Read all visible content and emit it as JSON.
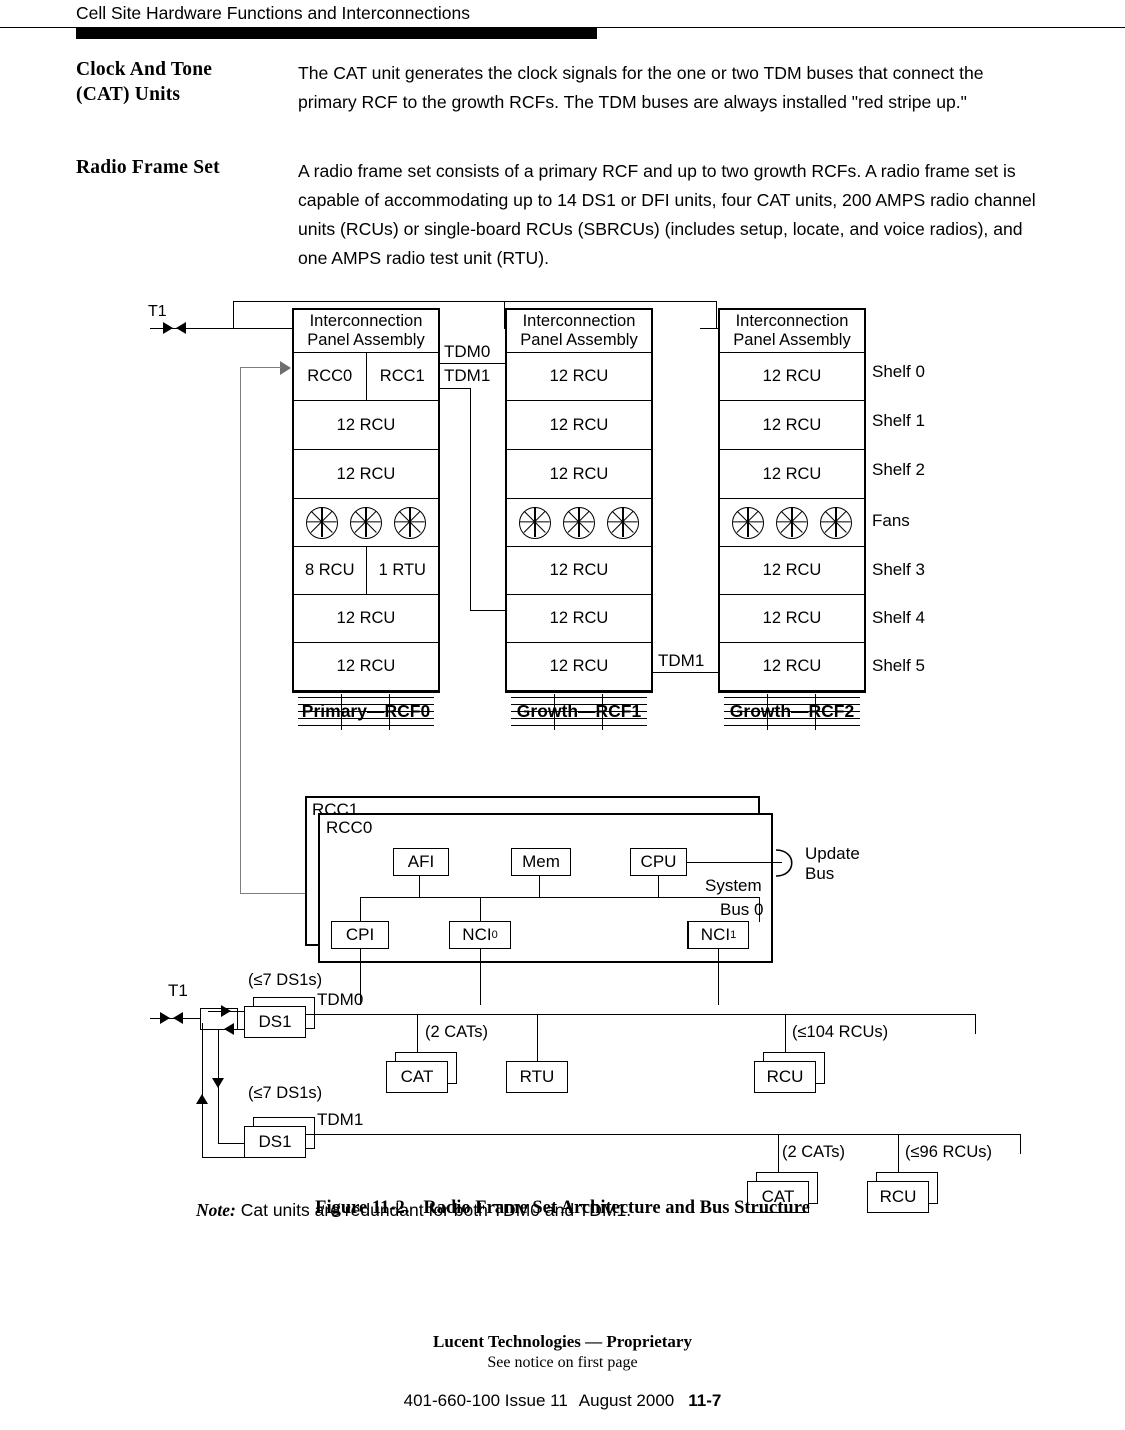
{
  "running_head": "Cell Site Hardware Functions and Interconnections",
  "sections": [
    {
      "heading_line1": "Clock And Tone",
      "heading_line2": "(CAT) Units",
      "body": "The CAT unit generates the clock signals for the one or two TDM buses that connect the primary RCF to the growth RCFs. The TDM buses are always installed \"red stripe up.\""
    },
    {
      "heading_line1": "Radio Frame Set",
      "heading_line2": "",
      "body": "A radio frame set consists of a primary RCF and up to two growth RCFs. A radio frame set is capable of accommodating up to 14 DS1 or DFI units, four CAT units, 200 AMPS radio channel units (RCUs) or single-board RCUs (SBRCUs) (includes setup, locate, and voice radios), and one AMPS radio test unit (RTU)."
    }
  ],
  "figure": {
    "t1_label_top": "T1",
    "t1_label_bottom": "T1",
    "tdm0_top": "TDM0",
    "tdm1_top": "TDM1",
    "tdm1_mid": "TDM1",
    "racks": [
      {
        "caption": "Primary—RCF0",
        "panel_title_line1": "Interconnection",
        "panel_title_line2": "Panel Assembly",
        "shelves": [
          {
            "type": "split",
            "left": "RCC0",
            "right": "RCC1"
          },
          {
            "type": "full",
            "label": "12 RCU"
          },
          {
            "type": "full",
            "label": "12 RCU"
          },
          {
            "type": "fans",
            "label": ""
          },
          {
            "type": "split",
            "left": "8 RCU",
            "right": "1 RTU"
          },
          {
            "type": "full",
            "label": "12 RCU"
          },
          {
            "type": "full",
            "label": "12 RCU"
          }
        ]
      },
      {
        "caption": "Growth—RCF1",
        "panel_title_line1": "Interconnection",
        "panel_title_line2": "Panel Assembly",
        "shelves": [
          {
            "type": "full",
            "label": "12 RCU"
          },
          {
            "type": "full",
            "label": "12 RCU"
          },
          {
            "type": "full",
            "label": "12 RCU"
          },
          {
            "type": "fans",
            "label": ""
          },
          {
            "type": "full",
            "label": "12 RCU"
          },
          {
            "type": "full",
            "label": "12 RCU"
          },
          {
            "type": "full",
            "label": "12 RCU"
          }
        ]
      },
      {
        "caption": "Growth—RCF2",
        "panel_title_line1": "Interconnection",
        "panel_title_line2": "Panel Assembly",
        "shelves": [
          {
            "type": "full",
            "label": "12 RCU"
          },
          {
            "type": "full",
            "label": "12 RCU"
          },
          {
            "type": "full",
            "label": "12 RCU"
          },
          {
            "type": "fans",
            "label": ""
          },
          {
            "type": "full",
            "label": "12 RCU"
          },
          {
            "type": "full",
            "label": "12 RCU"
          },
          {
            "type": "full",
            "label": "12 RCU"
          }
        ]
      }
    ],
    "shelf_names": [
      "Shelf 0",
      "Shelf 1",
      "Shelf 2",
      "Fans",
      "Shelf 3",
      "Shelf 4",
      "Shelf 5"
    ],
    "bus": {
      "rcc1_label": "RCC1",
      "rcc0_label": "RCC0",
      "afi": "AFI",
      "mem": "Mem",
      "cpu": "CPU",
      "cpi": "CPI",
      "nci0": "NCI",
      "nci0_sub": "0",
      "nci1": "NCI",
      "nci1_sub": "1",
      "update_bus_line1": "Update",
      "update_bus_line2": "Bus",
      "system_bus_line1": "System",
      "system_bus_line2": "Bus 0"
    },
    "lower": {
      "ds1_count_top": "(≤7 DS1s)",
      "ds1_count_bottom": "(≤7 DS1s)",
      "ds1_top": "DS1",
      "ds1_bottom": "DS1",
      "tdm0": "TDM0",
      "tdm1": "TDM1",
      "cat_count_top": "(2 CATs)",
      "cat_count_bottom": "(2 CATs)",
      "cat_top": "CAT",
      "cat_bottom": "CAT",
      "rtu": "RTU",
      "rcu_count_top": "(≤104 RCUs)",
      "rcu_count_bottom": "(≤96 RCUs)",
      "rcu_top": "RCU",
      "rcu_bottom": "RCU",
      "note_prefix": "Note:",
      "note_text": " Cat units are redundant for both TDM0 and TDM1."
    }
  },
  "caption": {
    "number": "Figure 11-2.",
    "title": "Radio Frame Set Architecture and Bus Structure"
  },
  "footer": {
    "proprietary": "Lucent Technologies — Proprietary",
    "notice": "See notice on first page",
    "docnum": "401-660-100 Issue 11",
    "date": "August 2000",
    "page": "11-7"
  }
}
